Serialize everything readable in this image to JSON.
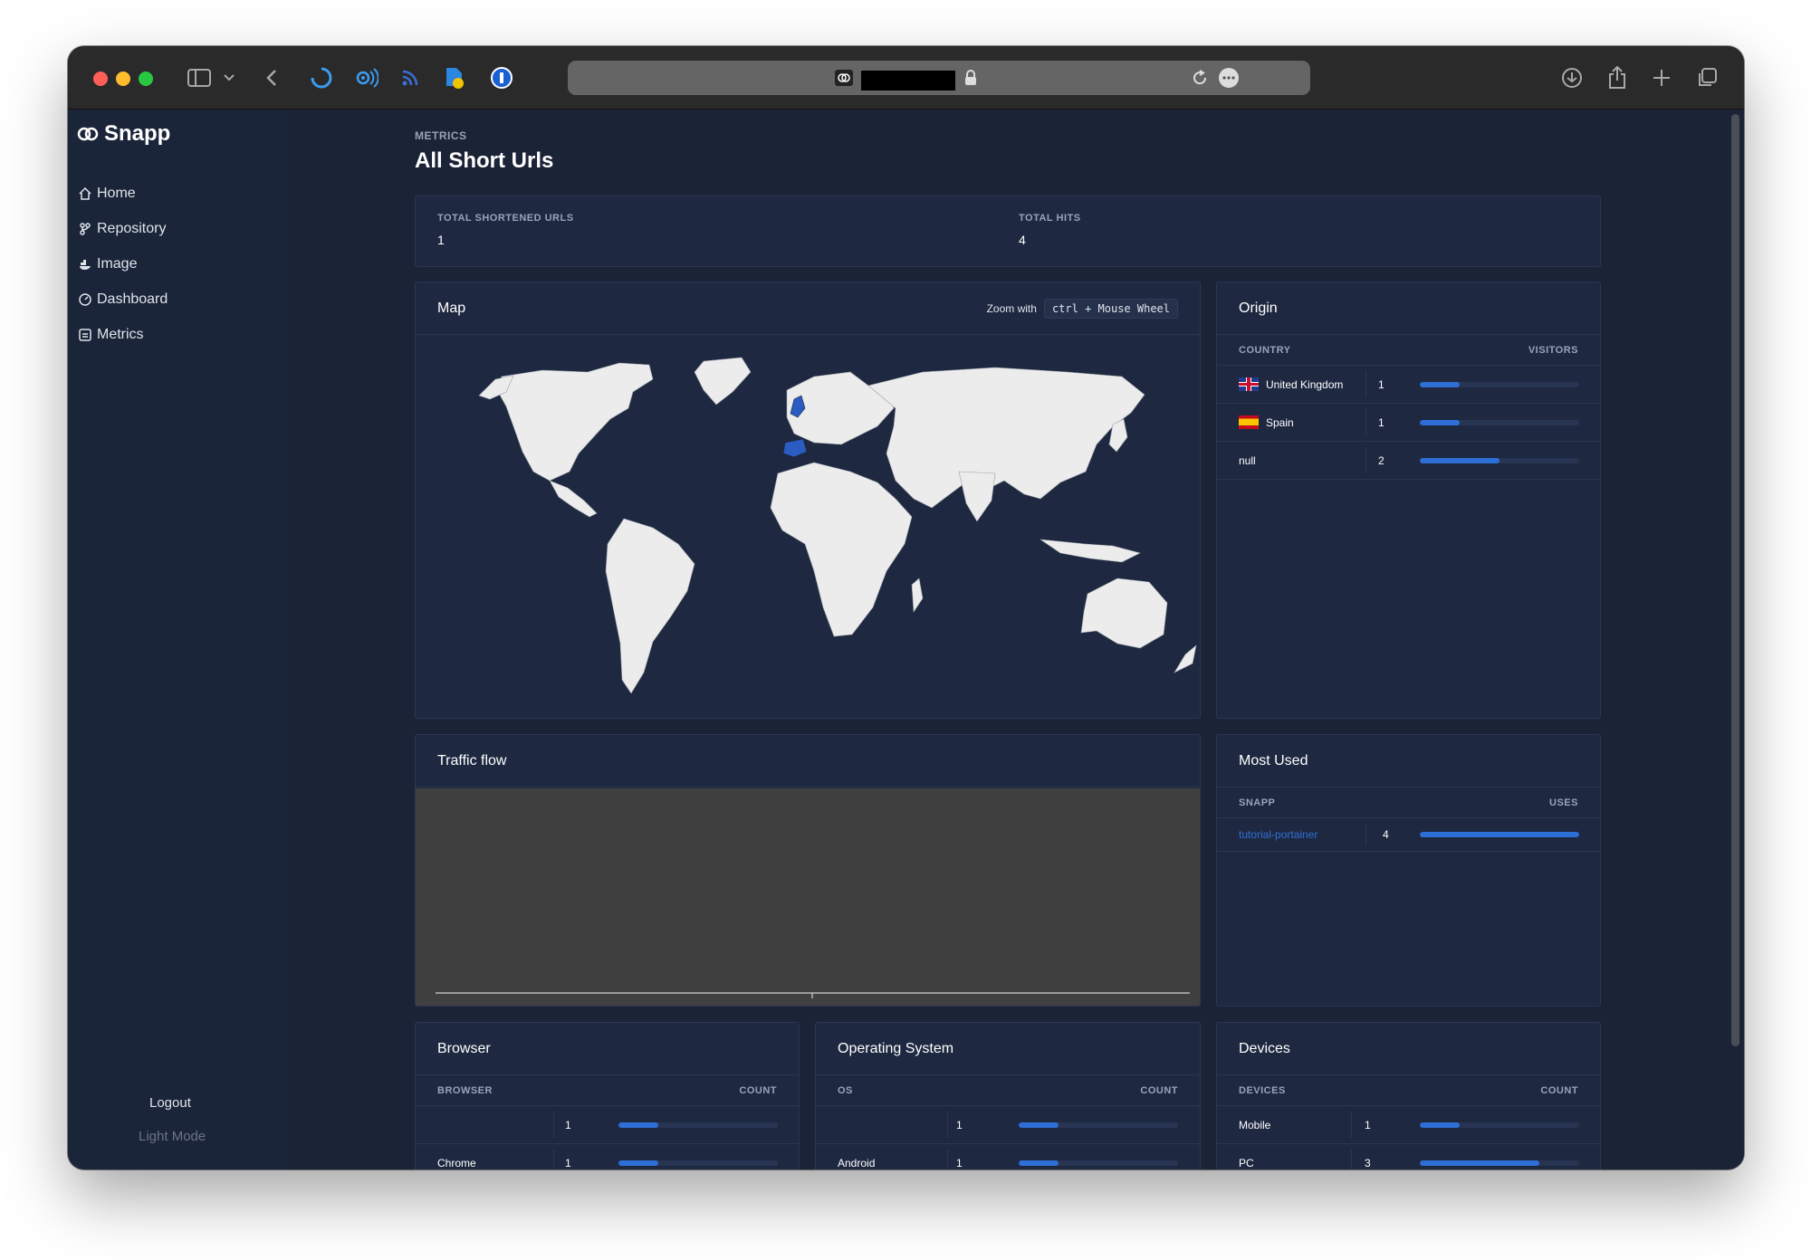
{
  "browser": {
    "url_redacted": true
  },
  "sidebar": {
    "brand": "Snapp",
    "items": [
      {
        "label": "Home",
        "icon": "home-icon"
      },
      {
        "label": "Repository",
        "icon": "git-icon"
      },
      {
        "label": "Image",
        "icon": "docker-icon"
      },
      {
        "label": "Dashboard",
        "icon": "dashboard-icon"
      },
      {
        "label": "Metrics",
        "icon": "chart-icon"
      }
    ],
    "logout": "Logout",
    "light_mode": "Light Mode"
  },
  "header": {
    "pretitle": "METRICS",
    "title": "All Short Urls"
  },
  "stats": {
    "total_urls_label": "TOTAL SHORTENED URLS",
    "total_urls_value": "1",
    "total_hits_label": "TOTAL HITS",
    "total_hits_value": "4"
  },
  "map": {
    "title": "Map",
    "zoom_hint": "Zoom with",
    "zoom_keys": "ctrl + Mouse Wheel",
    "highlighted_countries": [
      "United Kingdom",
      "Spain"
    ]
  },
  "origin": {
    "title": "Origin",
    "col1": "COUNTRY",
    "col2": "VISITORS",
    "max": 4,
    "rows": [
      {
        "country": "United Kingdom",
        "flag": "uk",
        "visitors": 1
      },
      {
        "country": "Spain",
        "flag": "es",
        "visitors": 1
      },
      {
        "country": "null",
        "flag": "",
        "visitors": 2
      }
    ]
  },
  "traffic": {
    "title": "Traffic flow"
  },
  "most_used": {
    "title": "Most Used",
    "col1": "SNAPP",
    "col2": "USES",
    "max": 4,
    "rows": [
      {
        "snapp": "tutorial-portainer",
        "uses": 4
      }
    ]
  },
  "browser_card": {
    "title": "Browser",
    "col1": "BROWSER",
    "col2": "COUNT",
    "max": 4,
    "rows": [
      {
        "name": "",
        "count": 1
      },
      {
        "name": "Chrome",
        "count": 1
      }
    ]
  },
  "os_card": {
    "title": "Operating System",
    "col1": "OS",
    "col2": "COUNT",
    "max": 4,
    "rows": [
      {
        "name": "",
        "count": 1
      },
      {
        "name": "Android",
        "count": 1
      }
    ]
  },
  "devices_card": {
    "title": "Devices",
    "col1": "DEVICES",
    "col2": "COUNT",
    "max": 4,
    "rows": [
      {
        "name": "Mobile",
        "count": 1
      },
      {
        "name": "PC",
        "count": 3
      }
    ]
  },
  "colors": {
    "accent": "#2d6fd6",
    "panel": "#1e2941",
    "background": "#1b2337",
    "map_land": "#ececec",
    "map_highlight": "#2a5cc2"
  }
}
